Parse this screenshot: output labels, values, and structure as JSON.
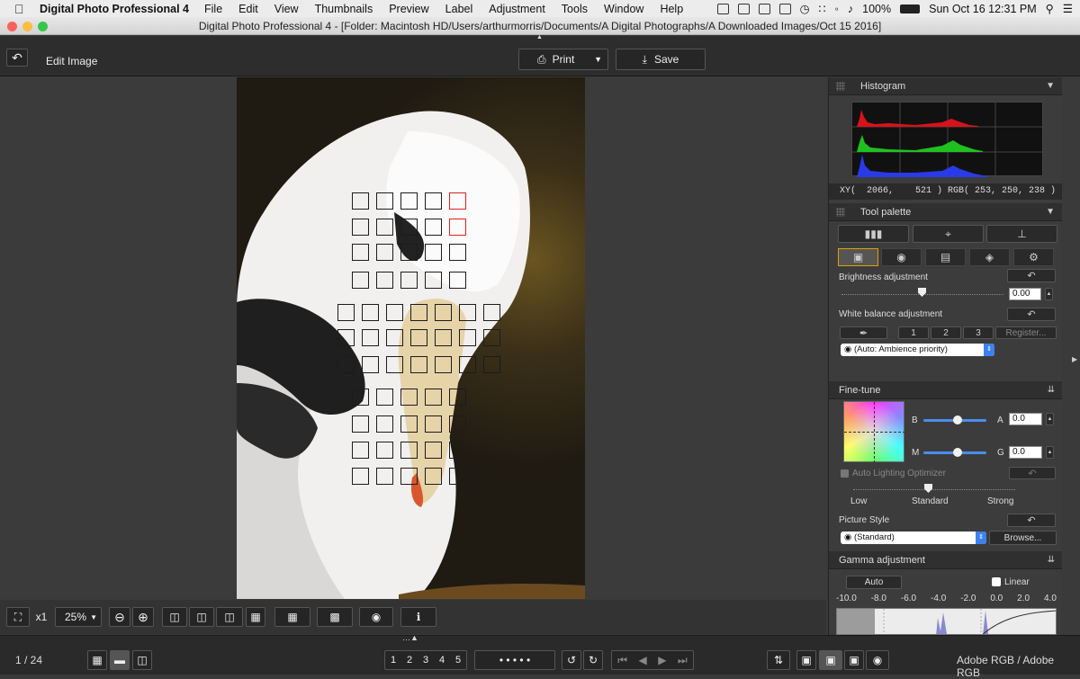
{
  "menubar": {
    "app_name": "Digital Photo Professional 4",
    "items": [
      "File",
      "Edit",
      "View",
      "Thumbnails",
      "Preview",
      "Label",
      "Adjustment",
      "Tools",
      "Window",
      "Help"
    ],
    "battery": "100%",
    "datetime": "Sun Oct 16  12:31 PM"
  },
  "window": {
    "title": "Digital Photo Professional 4 - [Folder: Macintosh HD/Users/arthurmorris/Documents/A Digital Photographs/A Downloaded Images/Oct 15 2016]"
  },
  "toolbar": {
    "back_icon": "undo-arrow-icon",
    "mode_label": "Edit Image",
    "print_label": "Print",
    "save_label": "Save"
  },
  "viewer": {
    "zoom_multiplier": "x1",
    "zoom_value": "25%"
  },
  "status": {
    "page_counter": "1 / 24",
    "color_space": "Adobe RGB / Adobe RGB"
  },
  "ratings": [
    "1",
    "2",
    "3",
    "4",
    "5"
  ],
  "histogram": {
    "title": "Histogram",
    "readout": "XY(  2066,    521 ) RGB( 253, 250, 238 )"
  },
  "tool_palette": {
    "title": "Tool palette",
    "brightness_label": "Brightness adjustment",
    "brightness_value": "0.00",
    "wb_label": "White balance adjustment",
    "wb_presets": [
      "1",
      "2",
      "3"
    ],
    "register_label": "Register...",
    "wb_mode": "(Auto: Ambience priority)"
  },
  "fine_tune": {
    "title": "Fine-tune",
    "b_label": "B",
    "a_label": "A",
    "a_value": "0.0",
    "m_label": "M",
    "g_label": "G",
    "g_value": "0.0",
    "alo_label": "Auto Lighting Optimizer",
    "low": "Low",
    "standard": "Standard",
    "strong": "Strong",
    "picture_style_label": "Picture Style",
    "picture_style_value": "(Standard)",
    "browse_label": "Browse..."
  },
  "gamma": {
    "title": "Gamma adjustment",
    "auto_label": "Auto",
    "linear_label": "Linear",
    "scale": [
      "-10.0",
      "-8.0",
      "-6.0",
      "-4.0",
      "-2.0",
      "0.0",
      "2.0",
      "4.0"
    ]
  },
  "colors": {
    "accent_tab": "#e0a000",
    "af_point_active": "#e02020",
    "slider_blue": "#4a8ef0"
  }
}
